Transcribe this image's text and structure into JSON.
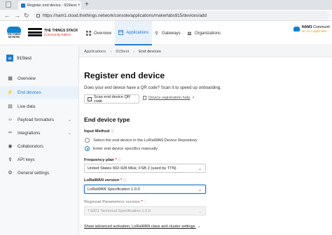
{
  "browser": {
    "tab_title": "Register end device - 915test - T",
    "tab_close": "×",
    "new_tab": "+",
    "url": "https://nam1.cloud.thethings.network/console/applications/makerfabs915/devices/add"
  },
  "header": {
    "ttn_logo_text": "THE THINGS NETWORK",
    "stack_name": "THE THINGS STACK",
    "stack_edition": "Community Edition",
    "nav": [
      {
        "label": "Overview",
        "icon": "overview-icon"
      },
      {
        "label": "Applications",
        "icon": "applications-icon"
      },
      {
        "label": "Gateways",
        "icon": "gateways-icon"
      },
      {
        "label": "Organizations",
        "icon": "organizations-icon"
      }
    ],
    "cluster": "NAM1",
    "cluster_suffix": "Communit",
    "sla_text": "No SLA applicable"
  },
  "sidebar": {
    "app_badge": "ttl",
    "app_name": "915test",
    "items": [
      {
        "label": "Overview",
        "icon": "overview-icon"
      },
      {
        "label": "End devices",
        "icon": "end-devices-icon"
      },
      {
        "label": "Live data",
        "icon": "live-data-icon"
      },
      {
        "label": "Payload formatters",
        "icon": "code-icon"
      },
      {
        "label": "Integrations",
        "icon": "integrations-icon"
      },
      {
        "label": "Collaborators",
        "icon": "collaborators-icon"
      },
      {
        "label": "API keys",
        "icon": "key-icon"
      },
      {
        "label": "General settings",
        "icon": "gear-icon"
      }
    ]
  },
  "breadcrumb": [
    "Applications",
    "915test",
    "End devices"
  ],
  "main": {
    "title": "Register end device",
    "qr_prompt": "Does your end device have a QR code? Scan it to speed up onboarding.",
    "qr_button": "Scan end device QR code",
    "help_link": "Device registration help",
    "section_title": "End device type",
    "input_method_label": "Input Method",
    "input_method_req": "ⓘ",
    "radio_repo": "Select the end device in the LoRaWAN Device Repository",
    "radio_manual": "Enter end device specifics manually",
    "freq_label": "Frequency plan",
    "freq_value": "United States 902-928 MHz, FSB 2 (used by TTN)",
    "lorawan_label": "LoRaWAN version",
    "lorawan_value": "LoRaWAN Specification 1.0.0",
    "regional_label": "Regional Parameters version",
    "regional_value": "TS001 Technical Specification 1.0.0",
    "advanced_link": "Show advanced activation, LoRaWAN class and cluster settings",
    "required_mark": "*"
  },
  "colors": {
    "accent": "#1f78d1",
    "ttn_blue": "#0d83d0",
    "edition_red": "#e2231a",
    "sla_orange": "#e79a12"
  }
}
